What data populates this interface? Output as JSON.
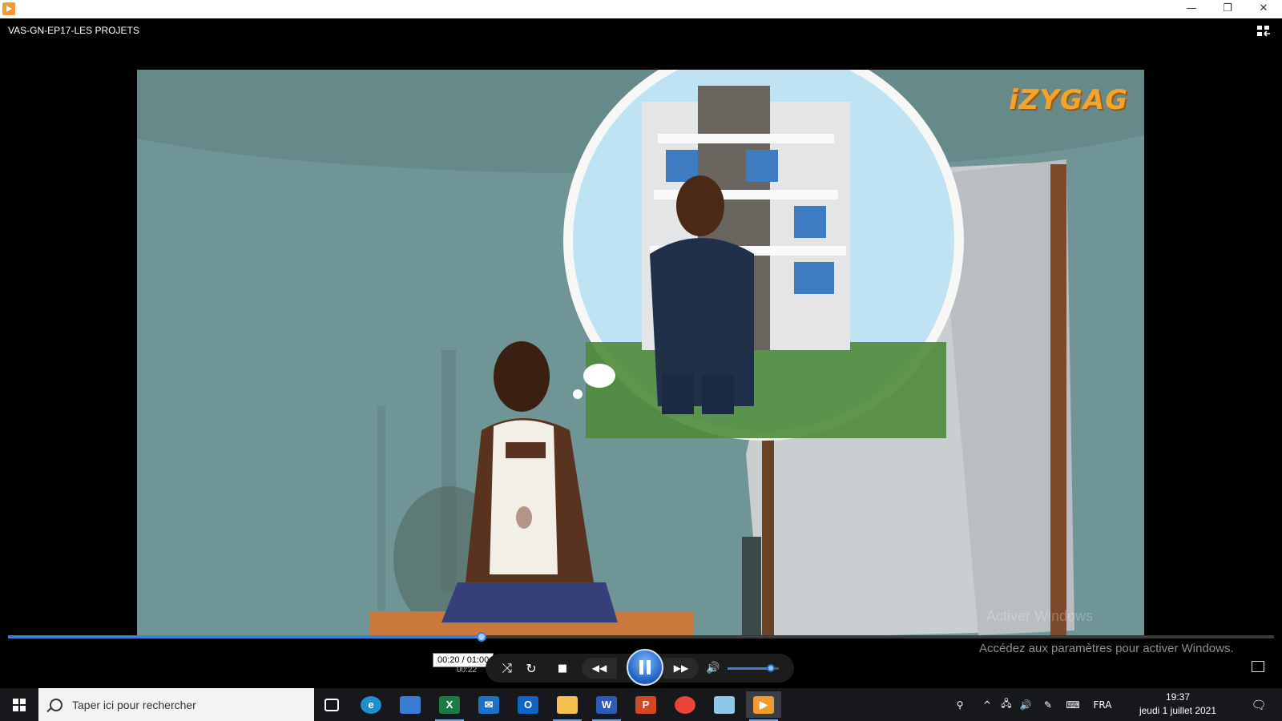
{
  "window": {
    "title": "VAS-GN-EP17-LES PROJETS",
    "minimize_glyph": "—",
    "restore_glyph": "❐",
    "close_glyph": "✕"
  },
  "video": {
    "logo_text": "iZYGAG",
    "watermark_line1": "Activer Windows",
    "watermark_line2": "Accédez aux paramètres pour activer Windows."
  },
  "seek": {
    "position_fraction": 0.374,
    "tooltip": "00:20 / 01:00",
    "elapsed_under": "00:22"
  },
  "controls": {
    "shuffle_icon": "⤨",
    "repeat_icon": "↻",
    "stop_icon": "■",
    "previous_icon": "◀◀",
    "next_icon": "▶▶",
    "volume_icon": "🔊",
    "volume_level": 0.85,
    "state": "playing"
  },
  "taskbar": {
    "search_placeholder": "Taper ici pour rechercher",
    "apps": [
      {
        "name": "task-view",
        "label": "",
        "color": "transparent"
      },
      {
        "name": "edge",
        "label": "e",
        "color": "#1f8ecf"
      },
      {
        "name": "store",
        "label": "",
        "color": "#3a7bd5"
      },
      {
        "name": "excel",
        "label": "X",
        "color": "#1e7a45"
      },
      {
        "name": "mail",
        "label": "✉",
        "color": "#1a73c9"
      },
      {
        "name": "outlook",
        "label": "O",
        "color": "#0f66c2"
      },
      {
        "name": "file-explorer",
        "label": "",
        "color": "#f2c14e"
      },
      {
        "name": "word",
        "label": "W",
        "color": "#2a5cb8"
      },
      {
        "name": "powerpoint",
        "label": "P",
        "color": "#d24726"
      },
      {
        "name": "chrome",
        "label": "",
        "color": "#e84335"
      },
      {
        "name": "app-blue",
        "label": "",
        "color": "#8fc7e8"
      },
      {
        "name": "media-player",
        "label": "▶",
        "color": "#f29a2e"
      }
    ],
    "tray": {
      "people_icon": "⚲",
      "chevron_icon": "^",
      "network_icon": "🖧",
      "volume_icon": "🔊",
      "pen_icon": "✎",
      "keyboard_icon": "⌨",
      "language": "FRA",
      "time": "19:37",
      "date": "jeudi 1 juillet 2021",
      "notifications_icon": "🗨"
    }
  }
}
